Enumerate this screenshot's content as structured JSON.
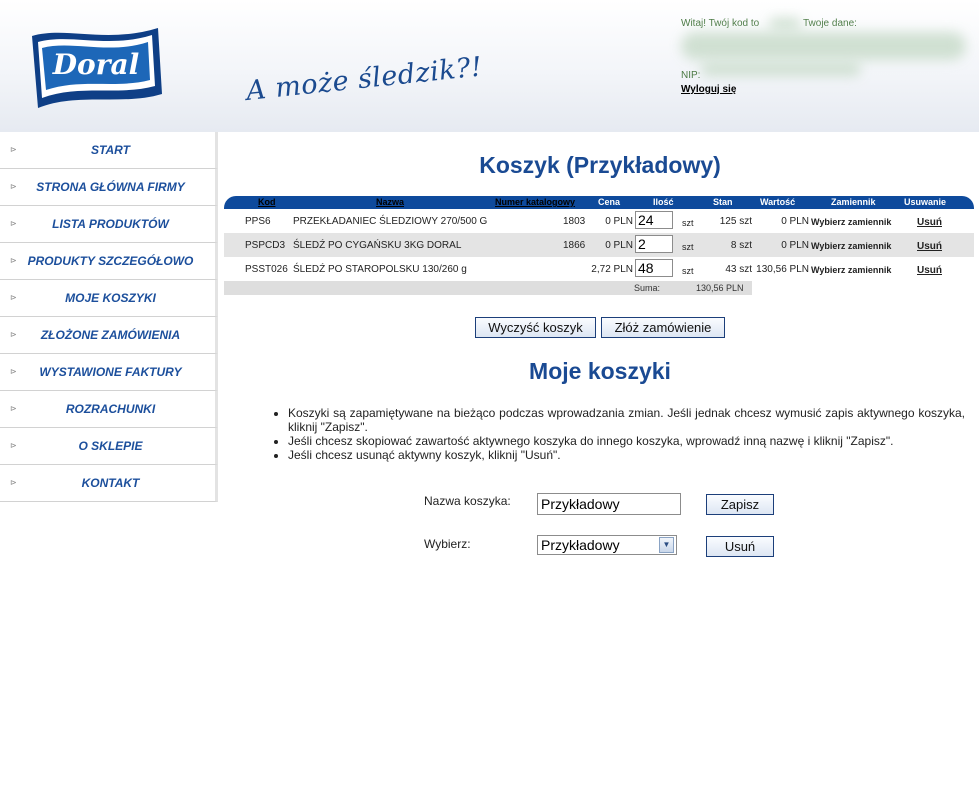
{
  "header": {
    "logo_text": "Doral",
    "slogan": "A może śledzik?!",
    "welcome": "Witaj! Twój kod to",
    "your_data": "Twoje dane:",
    "nip_label": "NIP:",
    "logout": "Wyloguj się"
  },
  "sidebar": {
    "items": [
      {
        "label": "START"
      },
      {
        "label": "STRONA GŁÓWNA FIRMY"
      },
      {
        "label": "LISTA PRODUKTÓW"
      },
      {
        "label": "PRODUKTY SZCZEGÓŁOWO"
      },
      {
        "label": "MOJE KOSZYKI"
      },
      {
        "label": "ZŁOŻONE ZAMÓWIENIA"
      },
      {
        "label": "WYSTAWIONE FAKTURY"
      },
      {
        "label": "ROZRACHUNKI"
      },
      {
        "label": "O SKLEPIE"
      },
      {
        "label": "KONTAKT"
      }
    ]
  },
  "cart": {
    "title": "Koszyk (Przykładowy)",
    "columns": {
      "kod": "Kod",
      "nazwa": "Nazwa",
      "numer": "Numer katalogowy",
      "cena": "Cena",
      "ilosc": "Ilość",
      "stan": "Stan",
      "wartosc": "Wartość",
      "zamiennik": "Zamiennik",
      "usuwanie": "Usuwanie"
    },
    "rows": [
      {
        "kod": "PPS6",
        "nazwa": "PRZEKŁADANIEC ŚLEDZIOWY 270/500 G",
        "numer": "1803",
        "cena": "0 PLN",
        "ilosc": "24",
        "jm": "szt",
        "stan": "125 szt",
        "wartosc": "0 PLN",
        "zamiennik": "Wybierz zamiennik",
        "usun": "Usuń"
      },
      {
        "kod": "PSPCD3",
        "nazwa": "ŚLEDŹ PO CYGAŃSKU 3KG DORAL",
        "numer": "1866",
        "cena": "0 PLN",
        "ilosc": "2",
        "jm": "szt",
        "stan": "8 szt",
        "wartosc": "0 PLN",
        "zamiennik": "Wybierz zamiennik",
        "usun": "Usuń"
      },
      {
        "kod": "PSST026",
        "nazwa": "ŚLEDŹ PO STAROPOLSKU 130/260 g",
        "numer": "",
        "cena": "2,72 PLN",
        "ilosc": "48",
        "jm": "szt",
        "stan": "43 szt",
        "wartosc": "130,56 PLN",
        "zamiennik": "Wybierz zamiennik",
        "usun": "Usuń"
      }
    ],
    "sum_label": "Suma:",
    "sum_value": "130,56 PLN",
    "clear_button": "Wyczyść koszyk",
    "order_button": "Złóż zamówienie"
  },
  "baskets": {
    "title": "Moje koszyki",
    "info": [
      "Koszyki są zapamiętywane na bieżąco podczas wprowadzania zmian. Jeśli jednak chcesz wymusić zapis aktywnego koszyka, kliknij \"Zapisz\".",
      "Jeśli chcesz skopiować zawartość aktywnego koszyka do innego koszyka, wprowadź inną nazwę i kliknij \"Zapisz\".",
      "Jeśli chcesz usunąć aktywny koszyk, kliknij \"Usuń\"."
    ],
    "name_label": "Nazwa koszyka:",
    "name_value": "Przykładowy",
    "save_button": "Zapisz",
    "select_label": "Wybierz:",
    "select_value": "Przykładowy",
    "delete_button": "Usuń"
  },
  "colors": {
    "accent": "#1a4a93",
    "table_header": "#0e4a9c",
    "alt_row": "#e4e4e4"
  }
}
